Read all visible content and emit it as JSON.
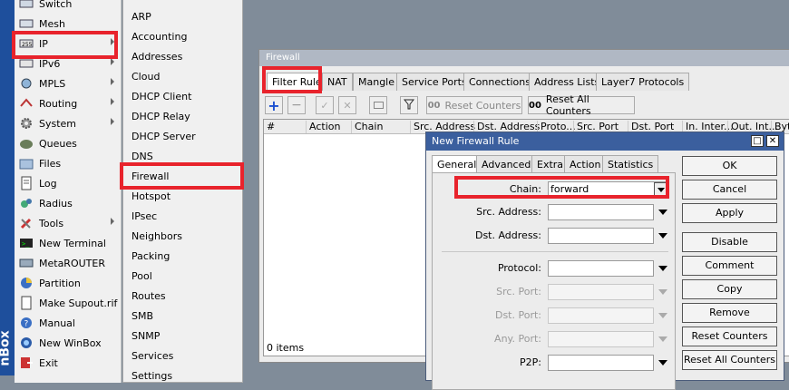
{
  "app": {
    "vertical_title": "nBox"
  },
  "sidebar": {
    "items": [
      {
        "label": "Switch",
        "icon": "switch-icon",
        "arrow": false
      },
      {
        "label": "Mesh",
        "icon": "mesh-icon",
        "arrow": false
      },
      {
        "label": "IP",
        "icon": "ip-icon",
        "arrow": true
      },
      {
        "label": "IPv6",
        "icon": "ipv6-icon",
        "arrow": true
      },
      {
        "label": "MPLS",
        "icon": "mpls-icon",
        "arrow": true
      },
      {
        "label": "Routing",
        "icon": "routing-icon",
        "arrow": true
      },
      {
        "label": "System",
        "icon": "gear-icon",
        "arrow": true
      },
      {
        "label": "Queues",
        "icon": "queues-icon",
        "arrow": false
      },
      {
        "label": "Files",
        "icon": "folder-icon",
        "arrow": false
      },
      {
        "label": "Log",
        "icon": "log-icon",
        "arrow": false
      },
      {
        "label": "Radius",
        "icon": "radius-icon",
        "arrow": false
      },
      {
        "label": "Tools",
        "icon": "tools-icon",
        "arrow": true
      },
      {
        "label": "New Terminal",
        "icon": "terminal-icon",
        "arrow": false
      },
      {
        "label": "MetaROUTER",
        "icon": "metarouter-icon",
        "arrow": false
      },
      {
        "label": "Partition",
        "icon": "partition-icon",
        "arrow": false
      },
      {
        "label": "Make Supout.rif",
        "icon": "supout-icon",
        "arrow": false
      },
      {
        "label": "Manual",
        "icon": "manual-icon",
        "arrow": false
      },
      {
        "label": "New WinBox",
        "icon": "winbox-icon",
        "arrow": false
      },
      {
        "label": "Exit",
        "icon": "exit-icon",
        "arrow": false
      }
    ]
  },
  "submenu": {
    "items": [
      "ARP",
      "Accounting",
      "Addresses",
      "Cloud",
      "DHCP Client",
      "DHCP Relay",
      "DHCP Server",
      "DNS",
      "Firewall",
      "Hotspot",
      "IPsec",
      "Neighbors",
      "Packing",
      "Pool",
      "Routes",
      "SMB",
      "SNMP",
      "Services",
      "Settings"
    ]
  },
  "firewall": {
    "title": "Firewall",
    "tabs": [
      "Filter Rules",
      "NAT",
      "Mangle",
      "Service Ports",
      "Connections",
      "Address Lists",
      "Layer7 Protocols"
    ],
    "reset_counters": "Reset Counters",
    "reset_all_counters": "Reset All Counters",
    "counter_icon": "00",
    "columns": [
      "#",
      "Action",
      "Chain",
      "Src. Address",
      "Dst. Address",
      "Proto...",
      "Src. Port",
      "Dst. Port",
      "In. Inter...",
      "Out. Int...",
      "Byt"
    ],
    "status": "0 items"
  },
  "dialog": {
    "title": "New Firewall Rule",
    "tabs": [
      "General",
      "Advanced",
      "Extra",
      "Action",
      "Statistics"
    ],
    "fields": {
      "chain_label": "Chain:",
      "chain_value": "forward",
      "src_address": "Src. Address:",
      "dst_address": "Dst. Address:",
      "protocol": "Protocol:",
      "src_port": "Src. Port:",
      "dst_port": "Dst. Port:",
      "any_port": "Any. Port:",
      "p2p": "P2P:"
    },
    "buttons": [
      "OK",
      "Cancel",
      "Apply",
      "Disable",
      "Comment",
      "Copy",
      "Remove",
      "Reset Counters",
      "Reset All Counters"
    ]
  },
  "colors": {
    "highlight": "#e8232c",
    "title_bar": "#3b5f9e"
  }
}
